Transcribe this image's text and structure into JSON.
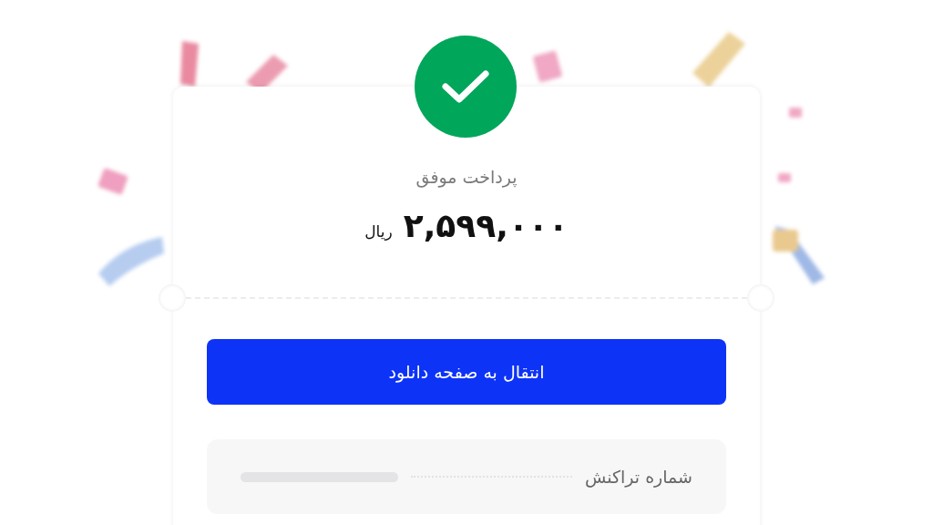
{
  "payment": {
    "title": "پرداخت موفق",
    "amount": "۲,۵۹۹,۰۰۰",
    "currency": "ریال"
  },
  "primary_button": {
    "label": "انتقال به صفحه دانلود"
  },
  "details": [
    {
      "label": "شماره تراکنش",
      "loading": true
    }
  ]
}
